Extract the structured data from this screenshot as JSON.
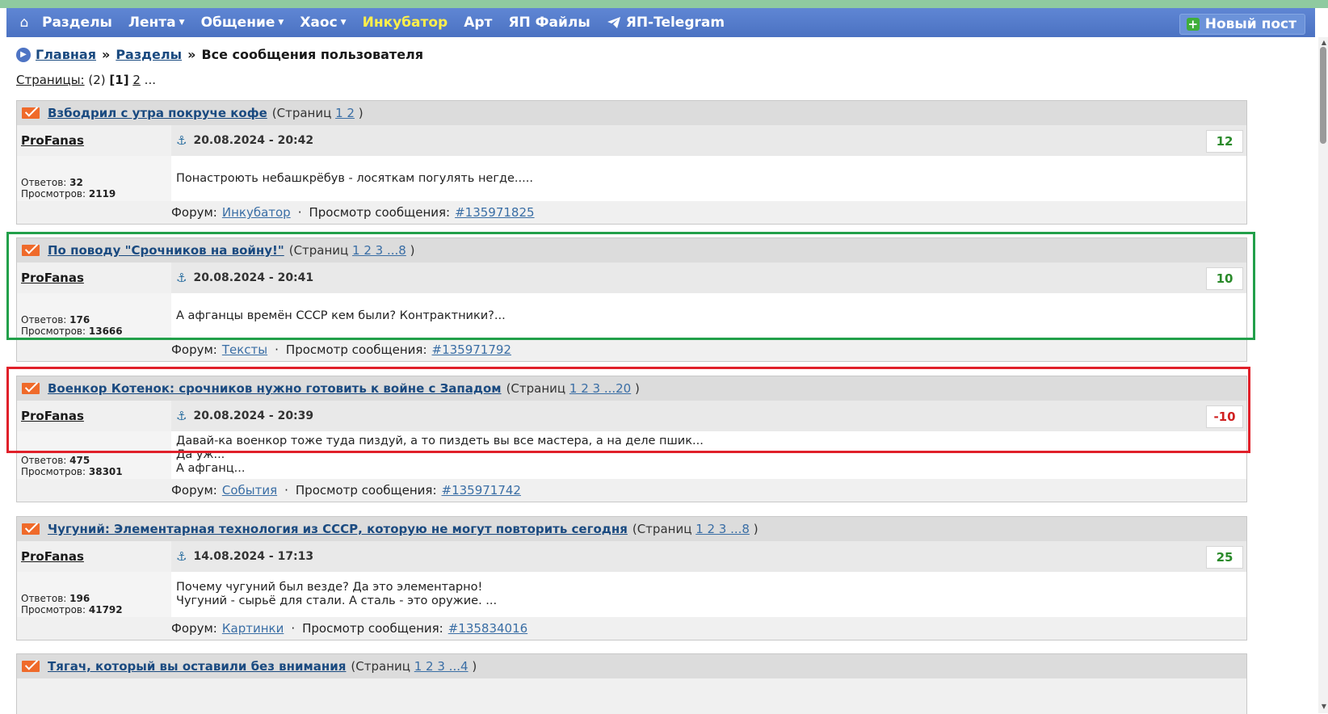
{
  "nav": {
    "home_icon": "home-icon",
    "items": [
      {
        "label": "Разделы",
        "dropdown": false,
        "highlight": false
      },
      {
        "label": "Лента",
        "dropdown": true,
        "highlight": false
      },
      {
        "label": "Общение",
        "dropdown": true,
        "highlight": false
      },
      {
        "label": "Хаос",
        "dropdown": true,
        "highlight": false
      },
      {
        "label": "Инкубатор",
        "dropdown": false,
        "highlight": true
      },
      {
        "label": "Арт",
        "dropdown": false,
        "highlight": false
      },
      {
        "label": "ЯП Файлы",
        "dropdown": false,
        "highlight": false
      },
      {
        "label": "ЯП-Telegram",
        "dropdown": false,
        "highlight": false,
        "icon": "telegram-icon"
      }
    ],
    "new_post": "Новый пост",
    "highlight_color": "#ffef4a"
  },
  "breadcrumb": {
    "home": "Главная",
    "sep": "»",
    "sections": "Разделы",
    "current": "Все сообщения пользователя"
  },
  "pager": {
    "label": "Страницы:",
    "count": "(2)",
    "current": "[1]",
    "next": "2",
    "more": "..."
  },
  "topics": [
    {
      "title": "Взбодрил с утра покруче кофе",
      "pages_prefix": "(Страниц",
      "pages": "1 2",
      "pages_suffix": ")",
      "author": "ProFanas",
      "date": "20.08.2024 - 20:42",
      "score": "12",
      "replies_label": "Ответов:",
      "replies": "32",
      "views_label": "Просмотров:",
      "views": "2119",
      "lines": [
        "Понастроють небашкрёбув - лосяткам погулять негде....."
      ],
      "forum_label": "Форум:",
      "forum": "Инкубатор",
      "view_label": "Просмотр сообщения:",
      "post_id": "#135971825"
    },
    {
      "title": "По поводу \"Срочников на войну!\"",
      "pages_prefix": "(Страниц",
      "pages": "1 2 3 ...8",
      "pages_suffix": ")",
      "author": "ProFanas",
      "date": "20.08.2024 - 20:41",
      "score": "10",
      "replies_label": "Ответов:",
      "replies": "176",
      "views_label": "Просмотров:",
      "views": "13666",
      "lines": [
        "А афганцы времён СССР кем были? Контрактники?..."
      ],
      "forum_label": "Форум:",
      "forum": "Тексты",
      "view_label": "Просмотр сообщения:",
      "post_id": "#135971792"
    },
    {
      "title": "Военкор Котенок: срочников нужно готовить к войне с Западом",
      "pages_prefix": "(Страниц",
      "pages": "1 2 3 ...20",
      "pages_suffix": ")",
      "author": "ProFanas",
      "date": "20.08.2024 - 20:39",
      "score": "-10",
      "replies_label": "Ответов:",
      "replies": "475",
      "views_label": "Просмотров:",
      "views": "38301",
      "lines": [
        "Давай-ка военкор тоже туда пиздуй, а то пиздеть вы все мастера, а на деле пшик...",
        "Да уж...",
        "А афганц..."
      ],
      "forum_label": "Форум:",
      "forum": "События",
      "view_label": "Просмотр сообщения:",
      "post_id": "#135971742"
    },
    {
      "title": "Чугуний: Элементарная технология из СССР, которую не могут повторить сегодня",
      "pages_prefix": "(Страниц",
      "pages": "1 2 3 ...8",
      "pages_suffix": ")",
      "author": "ProFanas",
      "date": "14.08.2024 - 17:13",
      "score": "25",
      "replies_label": "Ответов:",
      "replies": "196",
      "views_label": "Просмотров:",
      "views": "41792",
      "lines": [
        "Почему чугуний был везде? Да это элементарно!",
        "Чугуний - сырьё для стали. А сталь - это оружие. ..."
      ],
      "forum_label": "Форум:",
      "forum": "Картинки",
      "view_label": "Просмотр сообщения:",
      "post_id": "#135834016"
    },
    {
      "title": "Тягач, который вы оставили без внимания",
      "pages_prefix": "(Страниц",
      "pages": "1 2 3 ...4",
      "pages_suffix": ")"
    }
  ],
  "highlights": [
    {
      "color": "#22a04a",
      "target": 1
    },
    {
      "color": "#e0202a",
      "target": 2
    }
  ]
}
